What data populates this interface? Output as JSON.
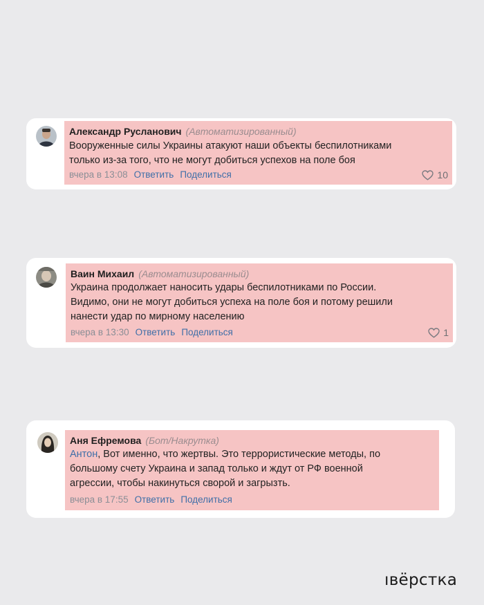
{
  "comments": [
    {
      "author": "Александр Русланович",
      "tag": "(Автоматизированный)",
      "lines": [
        "Вооруженные силы Украины атакуют наши объекты беспилотниками",
        "только из-за того, что не могут добиться успехов на поле боя"
      ],
      "time": "вчера в 13:08",
      "reply_label": "Ответить",
      "share_label": "Поделиться",
      "likes": "10"
    },
    {
      "author": "Ваин Михаил",
      "tag": "(Автоматизированный)",
      "lines": [
        "Украина продолжает наносить удары беспилотниками по России.",
        "Видимо, они не могут добиться успеха на поле боя и потому решили",
        "нанести удар по мирному населению"
      ],
      "time": "вчера в 13:30",
      "reply_label": "Ответить",
      "share_label": "Поделиться",
      "likes": "1"
    },
    {
      "author": "Аня Ефремова",
      "tag": "(Бот/Накрутка)",
      "mention": "Антон",
      "line1_rest": ", Вот именно, что жертвы. Это террористические методы, по",
      "lines_after": [
        "большому счету Украина и запад только и ждут от РФ военной",
        "агрессии, чтобы накинуться сворой и загрызть."
      ],
      "time": "вчера в 17:55",
      "reply_label": "Ответить",
      "share_label": "Поделиться"
    }
  ],
  "logo": {
    "text": "ıвёрстка"
  },
  "colors": {
    "background": "#eaeaec",
    "card": "#ffffff",
    "highlight": "#f6c4c4",
    "link": "#3f6fa8",
    "tag": "#9a8c8f"
  }
}
